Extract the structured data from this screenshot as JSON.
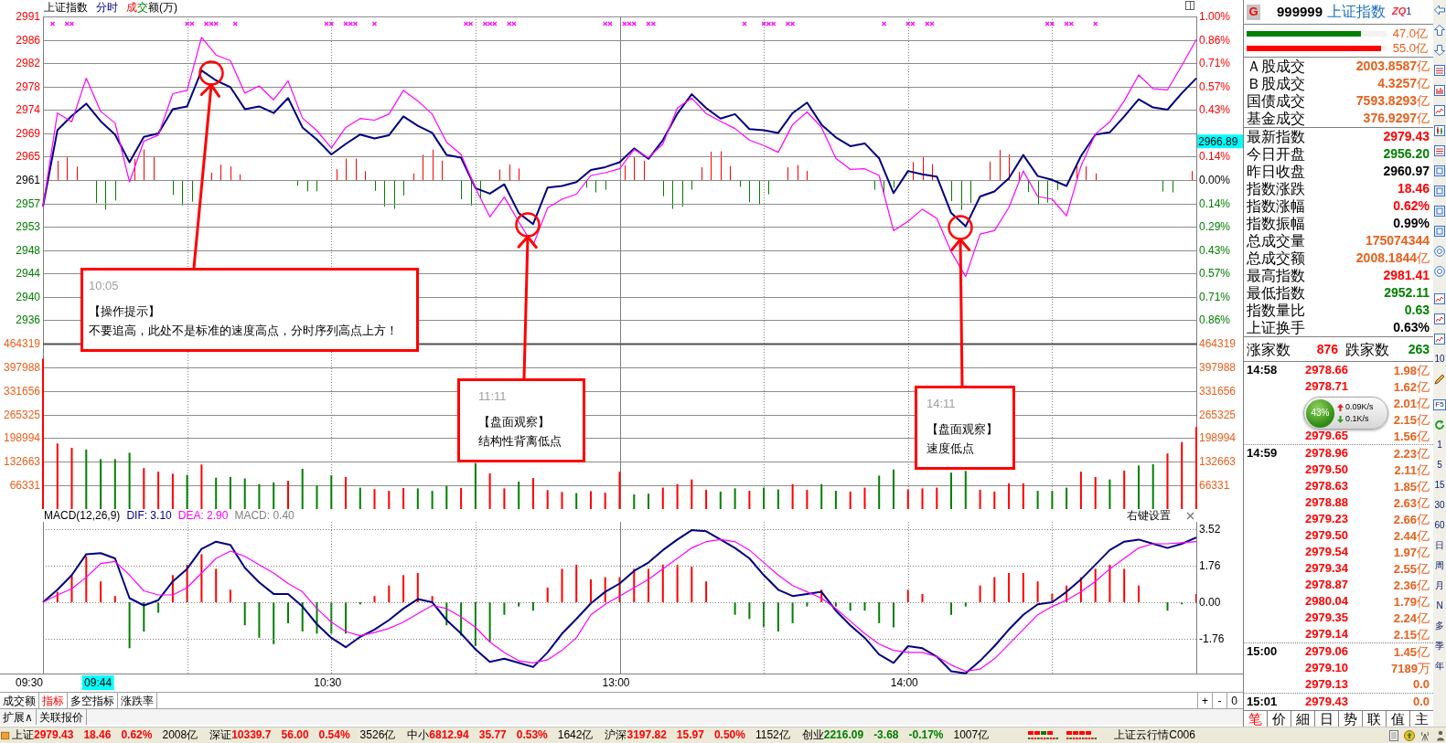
{
  "chart_header": {
    "title": "上证指数",
    "mode": "分时",
    "volume_legend": [
      {
        "text": "成",
        "kind": "up"
      },
      {
        "text": "交",
        "kind": "down"
      },
      {
        "text": "额(万)",
        "kind": "plain"
      }
    ]
  },
  "price_chart": {
    "chart_data": {
      "type": "line",
      "grid": true,
      "ylim": [
        2931.36,
        2990.58
      ],
      "yticks": [
        {
          "value": 2990.58,
          "label": "2991"
        },
        {
          "value": 2986.35,
          "label": "2986"
        },
        {
          "value": 2982.12,
          "label": "2982"
        },
        {
          "value": 2977.89,
          "label": "2978"
        },
        {
          "value": 2973.66,
          "label": "2974"
        },
        {
          "value": 2969.43,
          "label": "2969"
        },
        {
          "value": 2965.2,
          "label": "2965"
        },
        {
          "value": 2960.97,
          "label": "2961"
        },
        {
          "value": 2956.74,
          "label": "2957"
        },
        {
          "value": 2952.51,
          "label": "2953"
        },
        {
          "value": 2948.28,
          "label": "2948"
        },
        {
          "value": 2944.05,
          "label": "2944"
        },
        {
          "value": 2939.82,
          "label": "2940"
        },
        {
          "value": 2935.59,
          "label": "2936"
        }
      ],
      "series": [
        {
          "color": "#000080",
          "values": [
            2956.2,
            2970.0,
            2972.6,
            2974.8,
            2971.6,
            2969.2,
            2964.2,
            2968.8,
            2969.4,
            2973.8,
            2974.3,
            2980.8,
            2979.0,
            2977.8,
            2973.8,
            2974.3,
            2973.1,
            2975.8,
            2970.5,
            2968.3,
            2965.6,
            2967.5,
            2969.2,
            2968.5,
            2969.1,
            2972.5,
            2970.8,
            2969.5,
            2965.5,
            2965.0,
            2959.5,
            2958.5,
            2960.2,
            2955.0,
            2953.0,
            2959.6,
            2959.9,
            2960.6,
            2962.8,
            2963.3,
            2964.2,
            2966.7,
            2964.8,
            2968.2,
            2973.0,
            2976.5,
            2974.0,
            2972.1,
            2972.9,
            2970.2,
            2970.0,
            2969.5,
            2973.1,
            2975.0,
            2971.0,
            2968.7,
            2967.1,
            2967.6,
            2964.9,
            2958.6,
            2962.6,
            2962.0,
            2961.6,
            2955.0,
            2952.6,
            2958.0,
            2958.9,
            2961.3,
            2965.5,
            2961.7,
            2961.0,
            2959.9,
            2965.3,
            2969.2,
            2969.6,
            2972.5,
            2975.6,
            2974.1,
            2973.7,
            2976.7,
            2979.4
          ]
        },
        {
          "color": "#ff00ff",
          "values": [
            2956.2,
            2973.1,
            2971.5,
            2979.4,
            2973.4,
            2971.3,
            2960.6,
            2968.0,
            2969.1,
            2976.6,
            2977.2,
            2986.8,
            2983.6,
            2982.6,
            2976.7,
            2978.0,
            2975.5,
            2978.9,
            2972.2,
            2969.9,
            2966.8,
            2970.5,
            2972.1,
            2971.8,
            2972.9,
            2977.2,
            2975.3,
            2972.9,
            2967.8,
            2965.6,
            2959.5,
            2954.3,
            2957.9,
            2953.4,
            2949.2,
            2955.9,
            2957.5,
            2958.4,
            2961.8,
            2962.3,
            2963.0,
            2966.5,
            2965.0,
            2967.5,
            2974.0,
            2975.8,
            2973.0,
            2971.6,
            2970.3,
            2968.2,
            2967.2,
            2966.0,
            2971.0,
            2973.3,
            2970.5,
            2964.9,
            2962.9,
            2963.0,
            2961.8,
            2951.8,
            2953.5,
            2955.7,
            2954.0,
            2948.0,
            2943.5,
            2951.2,
            2951.8,
            2956.0,
            2962.6,
            2958.0,
            2957.5,
            2954.5,
            2963.5,
            2969.3,
            2971.5,
            2975.3,
            2980.0,
            2977.5,
            2977.3,
            2981.7,
            2986.4
          ]
        }
      ]
    },
    "percent_axis": {
      "upper": [
        "1.00%",
        "0.86%",
        "0.71%",
        "0.57%",
        "0.43%"
      ],
      "lower": [
        "0.14%",
        "0.00%",
        "0.14%",
        "0.29%",
        "0.43%",
        "0.57%",
        "0.71%",
        "0.86%"
      ]
    }
  },
  "cursor": {
    "value": "2966.89",
    "time": "09:44"
  },
  "callouts": [
    {
      "time": "10:05",
      "title": "【操作提示】",
      "text": "不要追高，此处不是标准的速度高点，分时序列高点上方！"
    },
    {
      "time": "11:11",
      "title": "【盘面观察】",
      "text": "结构性背离低点"
    },
    {
      "time": "14:11",
      "title": "【盘面观察】",
      "text": "速度低点"
    }
  ],
  "volume_chart": {
    "chart_data": {
      "type": "bar",
      "stacked": true,
      "grid": true,
      "ylim": [
        0,
        464319
      ],
      "yticks": [
        464319,
        397988,
        331656,
        265325,
        198994,
        132663,
        66331
      ],
      "series": [
        {
          "color": "#ff0000",
          "values": [
            422000,
            184000,
            172000,
            null,
            null,
            null,
            null,
            115000,
            105000,
            99000,
            null,
            125000,
            null,
            null,
            null,
            null,
            null,
            79000,
            null,
            null,
            null,
            90000,
            null,
            56000,
            51000,
            59000,
            null,
            null,
            null,
            59000,
            null,
            100000,
            58000,
            null,
            87000,
            53000,
            48000,
            null,
            50000,
            46000,
            105000,
            null,
            null,
            60000,
            70000,
            83000,
            54000,
            null,
            null,
            51000,
            null,
            null,
            70000,
            54000,
            null,
            null,
            49000,
            60000,
            null,
            null,
            55000,
            58000,
            60000,
            null,
            null,
            54000,
            49000,
            72000,
            72000,
            null,
            null,
            null,
            105000,
            90000,
            null,
            108000,
            null,
            null,
            156000,
            188000,
            230000
          ]
        },
        {
          "color": "#008000",
          "values": [
            null,
            null,
            null,
            167000,
            140000,
            140000,
            158000,
            null,
            null,
            null,
            96000,
            null,
            88000,
            90000,
            86000,
            70000,
            75000,
            null,
            113000,
            66000,
            95000,
            null,
            60000,
            null,
            null,
            null,
            58000,
            51000,
            65000,
            null,
            129000,
            null,
            null,
            77000,
            null,
            null,
            null,
            45000,
            null,
            null,
            null,
            41000,
            43000,
            null,
            null,
            null,
            null,
            49000,
            58000,
            null,
            60000,
            55000,
            null,
            null,
            70000,
            51000,
            null,
            null,
            94000,
            111000,
            null,
            null,
            null,
            102000,
            107000,
            null,
            null,
            null,
            null,
            51000,
            51000,
            60000,
            null,
            null,
            83000,
            null,
            122000,
            126000,
            null,
            null,
            null
          ]
        }
      ]
    },
    "right_axis": [
      "464319",
      "397988",
      "331656",
      "265325",
      "198994",
      "132663",
      "66331"
    ]
  },
  "indicator_header": {
    "title": "MACD(12,26,9)",
    "values": [
      {
        "text": "DIF: 3.10",
        "color": "#000080"
      },
      {
        "text": "DEA: 2.90",
        "color": "#ff00ff"
      },
      {
        "text": "MACD: 0.40",
        "color": "#808080"
      }
    ],
    "settings": "右键设置"
  },
  "macd_chart": {
    "chart_data": {
      "type": "line",
      "grid": true,
      "ylim": [
        -3.41,
        3.85
      ],
      "yticks": [
        3.52,
        1.76,
        {
          "value": 0,
          "label": "0.00"
        },
        -1.76
      ],
      "series": [
        {
          "color": "#000080",
          "values": [
            0.0,
            0.6,
            1.3,
            2.3,
            2.35,
            2.1,
            0.2,
            -0.15,
            0.1,
            1.0,
            1.6,
            2.55,
            2.9,
            2.75,
            1.65,
            0.95,
            0.4,
            0.4,
            -0.2,
            -1.05,
            -1.7,
            -2.15,
            -1.65,
            -1.3,
            -0.85,
            -0.3,
            0.15,
            0.0,
            -0.85,
            -1.5,
            -2.25,
            -2.85,
            -2.7,
            -2.9,
            -3.1,
            -2.4,
            -1.5,
            -0.8,
            -0.05,
            0.5,
            0.9,
            1.5,
            1.9,
            2.5,
            3.0,
            3.45,
            3.4,
            3.0,
            2.6,
            2.1,
            1.3,
            0.6,
            0.3,
            0.4,
            0.5,
            -0.4,
            -1.1,
            -1.7,
            -2.5,
            -2.9,
            -2.1,
            -2.2,
            -2.6,
            -3.3,
            -3.4,
            -2.8,
            -2.1,
            -1.3,
            -0.6,
            -0.1,
            0.0,
            0.5,
            1.1,
            1.8,
            2.5,
            2.9,
            3.0,
            2.8,
            2.6,
            2.8,
            3.1
          ]
        },
        {
          "color": "#ff00ff",
          "values": [
            0.0,
            0.35,
            0.65,
            1.2,
            1.85,
            1.95,
            1.3,
            0.55,
            0.35,
            0.35,
            0.7,
            1.4,
            2.1,
            2.45,
            2.2,
            1.8,
            1.4,
            0.9,
            0.5,
            -0.3,
            -0.95,
            -1.4,
            -1.6,
            -1.45,
            -1.25,
            -0.95,
            -0.55,
            -0.15,
            -0.3,
            -0.7,
            -1.2,
            -1.9,
            -2.4,
            -2.8,
            -2.9,
            -2.75,
            -2.3,
            -1.7,
            -0.6,
            -0.1,
            0.3,
            0.7,
            1.1,
            1.6,
            2.1,
            2.6,
            2.9,
            3.0,
            2.9,
            2.5,
            1.9,
            1.3,
            0.8,
            0.5,
            0.2,
            -0.3,
            -0.9,
            -1.5,
            -2.0,
            -2.3,
            -2.4,
            -2.4,
            -2.6,
            -3.0,
            -3.3,
            -3.2,
            -2.7,
            -2.0,
            -1.3,
            -0.6,
            -0.2,
            0.1,
            0.5,
            1.0,
            1.6,
            2.1,
            2.6,
            2.8,
            2.8,
            2.85,
            2.9
          ]
        }
      ]
    }
  },
  "time_axis": [
    "09:30",
    "10:30",
    "13:00",
    "14:00"
  ],
  "indicator_tabs": [
    {
      "label": "成交额",
      "selected": false
    },
    {
      "label": "指标",
      "selected": true
    },
    {
      "label": "多空指标",
      "selected": false
    },
    {
      "label": "涨跌率",
      "selected": false
    }
  ],
  "zoom_buttons": [
    "+",
    "-",
    "0"
  ],
  "extra_tabs": [
    "扩展∧",
    "关联报价"
  ],
  "quote_panel": {
    "badge": "G",
    "code": "999999",
    "name": "上证指数",
    "tag": "ZQ",
    "tag_suffix": "1",
    "flow_bars": [
      {
        "level": 0.82,
        "amount": "47.0亿",
        "color": "#008000"
      },
      {
        "level": 0.96,
        "amount": "55.0亿",
        "color": "#ff0000"
      }
    ],
    "turnover": [
      {
        "label": "Ａ股成交",
        "value": "2003.8587",
        "unit": "亿"
      },
      {
        "label": "Ｂ股成交",
        "value": "4.3257",
        "unit": "亿"
      },
      {
        "label": "国债成交",
        "value": "7593.8293",
        "unit": "亿"
      },
      {
        "label": "基金成交",
        "value": "376.9297",
        "unit": "亿"
      }
    ],
    "stats": [
      {
        "label": "最新指数",
        "value": "2979.43",
        "color": "#ff0000"
      },
      {
        "label": "今日开盘",
        "value": "2956.20",
        "color": "#008000"
      },
      {
        "label": "昨日收盘",
        "value": "2960.97",
        "color": "#000000"
      },
      {
        "label": "指数涨跌",
        "value": "18.46",
        "color": "#ff0000"
      },
      {
        "label": "指数涨幅",
        "value": "0.62%",
        "color": "#ff0000"
      },
      {
        "label": "指数振幅",
        "value": "0.99%",
        "color": "#000000"
      },
      {
        "label": "总成交量",
        "value": "175074344",
        "color": "#e8601c"
      },
      {
        "label": "总成交额",
        "value": "2008.1844",
        "unit": "亿",
        "color": "#e8601c"
      },
      {
        "label": "最高指数",
        "value": "2981.41",
        "color": "#ff0000"
      },
      {
        "label": "最低指数",
        "value": "2952.11",
        "color": "#008000"
      },
      {
        "label": "指数量比",
        "value": "0.63",
        "color": "#008000"
      },
      {
        "label": "上证换手",
        "value": "0.63%",
        "color": "#000000"
      }
    ],
    "breadth": {
      "up_label": "涨家数",
      "up_count": "876",
      "down_label": "跌家数",
      "down_count": "263"
    },
    "ticks": [
      {
        "time": "14:58",
        "rows": [
          {
            "price": "2978.66",
            "amount": "1.98",
            "unit": "亿"
          },
          {
            "price": "2978.71",
            "amount": "1.62",
            "unit": "亿"
          },
          {
            "amount": "2.01",
            "unit": "亿"
          },
          {
            "amount": "2.15",
            "unit": "亿"
          },
          {
            "price": "2979.65",
            "amount": "1.56",
            "unit": "亿"
          }
        ]
      },
      {
        "time": "14:59",
        "rows": [
          {
            "price": "2978.96",
            "amount": "2.23",
            "unit": "亿"
          },
          {
            "price": "2979.50",
            "amount": "2.11",
            "unit": "亿"
          },
          {
            "price": "2978.63",
            "amount": "1.85",
            "unit": "亿"
          },
          {
            "price": "2978.88",
            "amount": "2.63",
            "unit": "亿"
          },
          {
            "price": "2979.23",
            "amount": "2.66",
            "unit": "亿"
          },
          {
            "price": "2979.50",
            "amount": "2.44",
            "unit": "亿"
          },
          {
            "price": "2979.54",
            "amount": "1.97",
            "unit": "亿"
          },
          {
            "price": "2979.34",
            "amount": "2.55",
            "unit": "亿"
          },
          {
            "price": "2978.87",
            "amount": "2.36",
            "unit": "亿"
          },
          {
            "price": "2980.04",
            "amount": "1.79",
            "unit": "亿"
          },
          {
            "price": "2979.35",
            "amount": "2.24",
            "unit": "亿"
          },
          {
            "price": "2979.14",
            "amount": "2.15",
            "unit": "亿"
          }
        ]
      },
      {
        "time": "15:00",
        "rows": [
          {
            "price": "2979.06",
            "amount": "1.45",
            "unit": "亿"
          },
          {
            "price": "2979.10",
            "amount": "7189",
            "unit": "万"
          },
          {
            "price": "2979.13",
            "amount": "0.0"
          }
        ]
      },
      {
        "time": "15:01",
        "rows": [
          {
            "price": "2979.43",
            "amount": "0.0"
          }
        ]
      }
    ],
    "tabs": [
      {
        "label": "笔",
        "selected": true
      },
      {
        "label": "价",
        "selected": false
      },
      {
        "label": "細",
        "selected": false
      },
      {
        "label": "日",
        "selected": false
      },
      {
        "label": "势",
        "selected": false
      },
      {
        "label": "联",
        "selected": false
      },
      {
        "label": "值",
        "selected": false
      },
      {
        "label": "主",
        "selected": false
      }
    ]
  },
  "speed_widget": {
    "percent": "43%",
    "upload": "0.09K/s",
    "download": "0.1K/s"
  },
  "side_toolbar": {
    "scale_label": "10",
    "refresh_key": "F5",
    "periods": [
      "1",
      "5",
      "15",
      "30",
      "60",
      "日",
      "周",
      "月",
      "N",
      "多",
      "季",
      "年"
    ]
  },
  "status_bar": {
    "indices": [
      {
        "name": "上证",
        "value": "2979.43",
        "change": "18.46",
        "percent": "0.62%",
        "amount": "2008亿",
        "color": "#ff0000"
      },
      {
        "name": "深证",
        "value": "10339.7",
        "change": "56.00",
        "percent": "0.54%",
        "amount": "3526亿",
        "color": "#ff0000"
      },
      {
        "name": "中小",
        "value": "6812.94",
        "change": "35.77",
        "percent": "0.53%",
        "amount": "1642亿",
        "color": "#ff0000"
      },
      {
        "name": "沪深",
        "value": "3197.82",
        "change": "15.97",
        "percent": "0.50%",
        "amount": "1152亿",
        "color": "#ff0000"
      },
      {
        "name": "创业",
        "value": "2216.09",
        "change": "-3.68",
        "percent": "-0.17%",
        "amount": "1007亿",
        "color": "#008000"
      }
    ],
    "service": "上证云行情C006"
  }
}
